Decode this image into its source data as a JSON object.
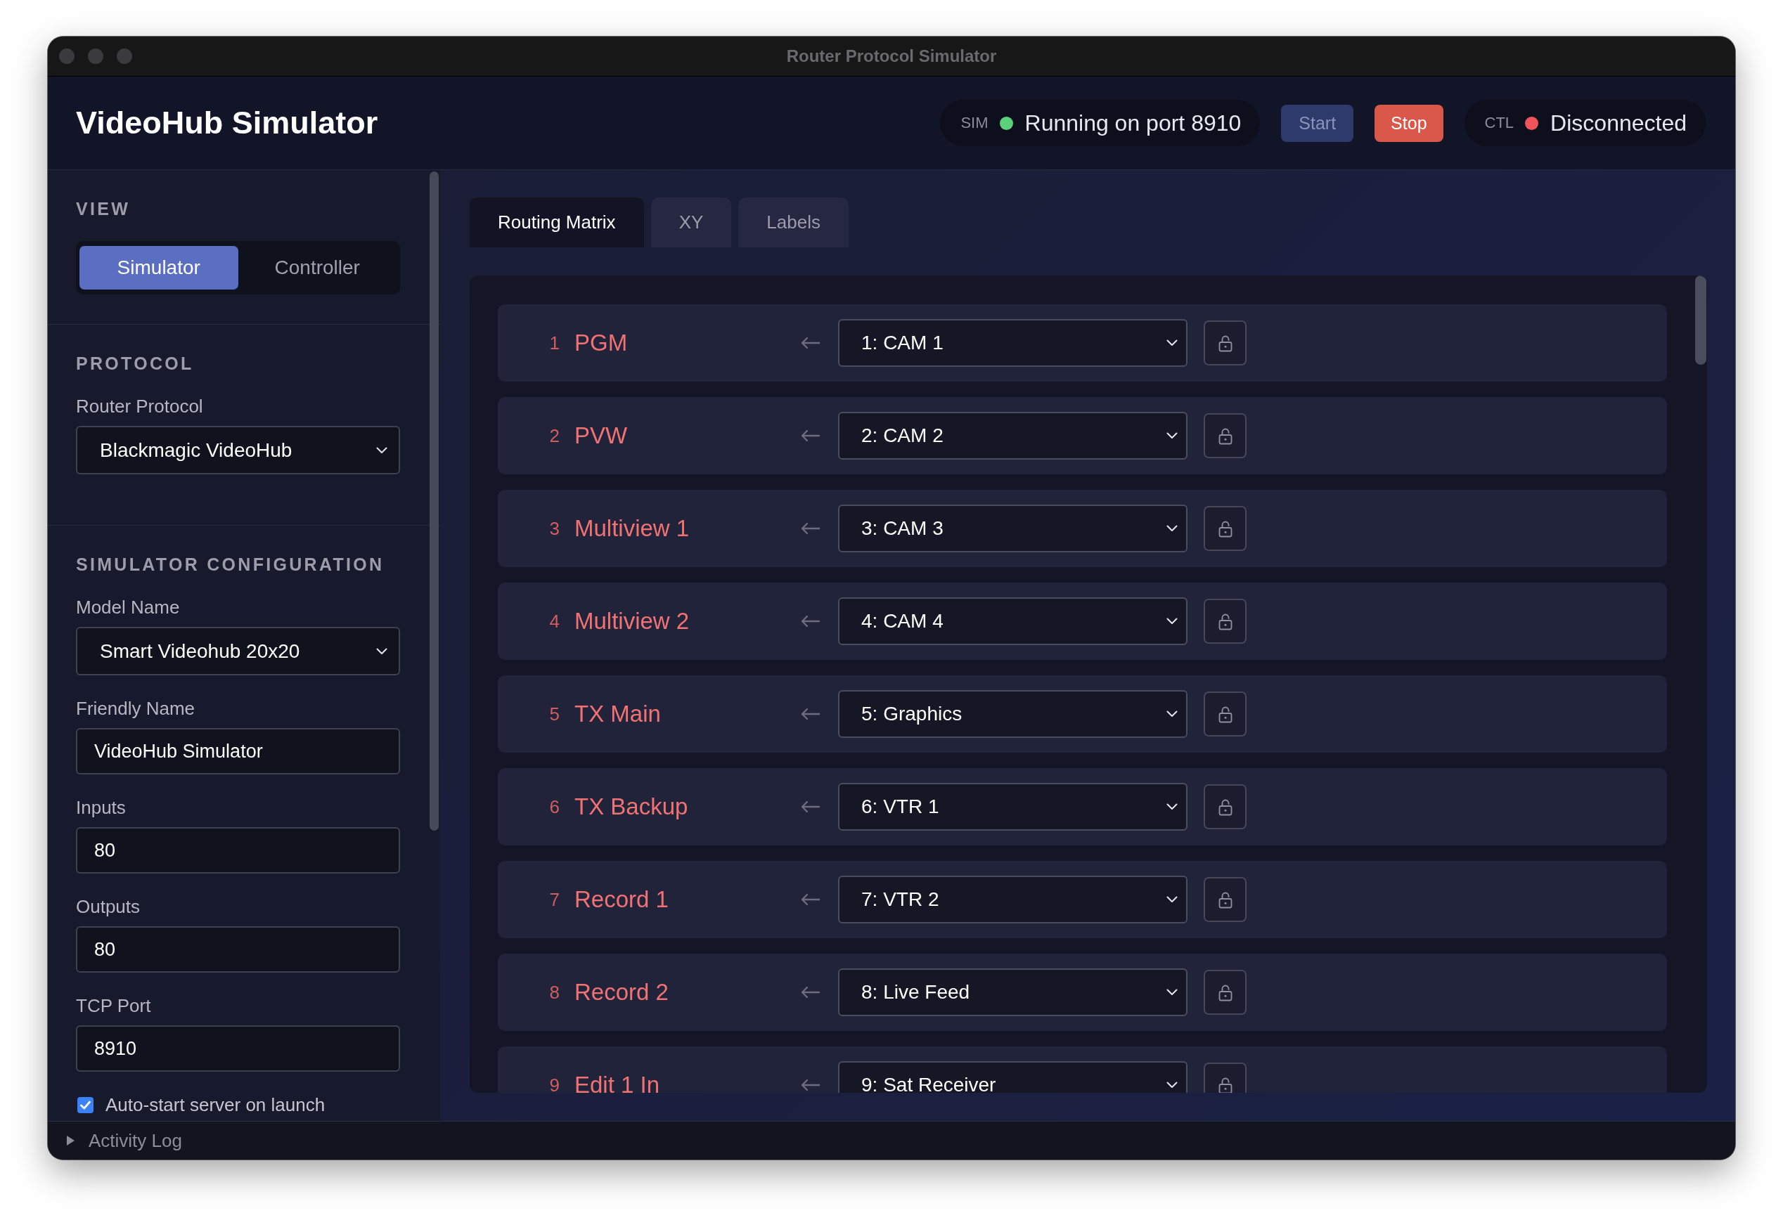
{
  "window": {
    "title": "Router Protocol Simulator"
  },
  "header": {
    "title": "VideoHub Simulator",
    "items": [
      {
        "kind": "status",
        "label": "SIM",
        "text": "Running on port 8910",
        "color": "#5cd17b"
      },
      {
        "kind": "start",
        "label": "Start",
        "disabled": true
      },
      {
        "kind": "stop",
        "label": "Stop",
        "disabled": false
      },
      {
        "kind": "status",
        "label": "CTL",
        "text": "Disconnected",
        "color": "#ef5459"
      }
    ]
  },
  "sidebar": {
    "sections": [
      {
        "title": "VIEW",
        "fields": [
          {
            "kind": "segmented",
            "options": [
              {
                "label": "Simulator",
                "selected": true
              },
              {
                "label": "Controller",
                "selected": false
              }
            ]
          }
        ]
      },
      {
        "title": "PROTOCOL",
        "fields": [
          {
            "kind": "select",
            "label": "Router Protocol",
            "value": "Blackmagic VideoHub"
          }
        ]
      },
      {
        "title": "SIMULATOR CONFIGURATION",
        "fields": [
          {
            "kind": "select",
            "label": "Model Name",
            "value": "Smart Videohub 20x20"
          },
          {
            "kind": "text",
            "label": "Friendly Name",
            "value": "VideoHub Simulator"
          },
          {
            "kind": "text",
            "label": "Inputs",
            "value": "80"
          },
          {
            "kind": "text",
            "label": "Outputs",
            "value": "80"
          },
          {
            "kind": "text",
            "label": "TCP Port",
            "value": "8910"
          },
          {
            "kind": "checkbox",
            "label": "Auto-start server on launch",
            "checked": true
          }
        ]
      }
    ]
  },
  "main": {
    "tabs": [
      {
        "label": "Routing Matrix",
        "selected": true
      },
      {
        "label": "XY",
        "selected": false
      },
      {
        "label": "Labels",
        "selected": false
      }
    ],
    "routes": [
      {
        "number": "1",
        "name": "PGM",
        "source": "1: CAM 1",
        "locked": false
      },
      {
        "number": "2",
        "name": "PVW",
        "source": "2: CAM 2",
        "locked": false
      },
      {
        "number": "3",
        "name": "Multiview 1",
        "source": "3: CAM 3",
        "locked": false
      },
      {
        "number": "4",
        "name": "Multiview 2",
        "source": "4: CAM 4",
        "locked": false
      },
      {
        "number": "5",
        "name": "TX Main",
        "source": "5: Graphics",
        "locked": false
      },
      {
        "number": "6",
        "name": "TX Backup",
        "source": "6: VTR 1",
        "locked": false
      },
      {
        "number": "7",
        "name": "Record 1",
        "source": "7: VTR 2",
        "locked": false
      },
      {
        "number": "8",
        "name": "Record 2",
        "source": "8: Live Feed",
        "locked": false
      },
      {
        "number": "9",
        "name": "Edit 1 In",
        "source": "9: Sat Receiver",
        "locked": false
      }
    ]
  },
  "activity_log": {
    "label": "Activity Log",
    "expanded": false
  }
}
